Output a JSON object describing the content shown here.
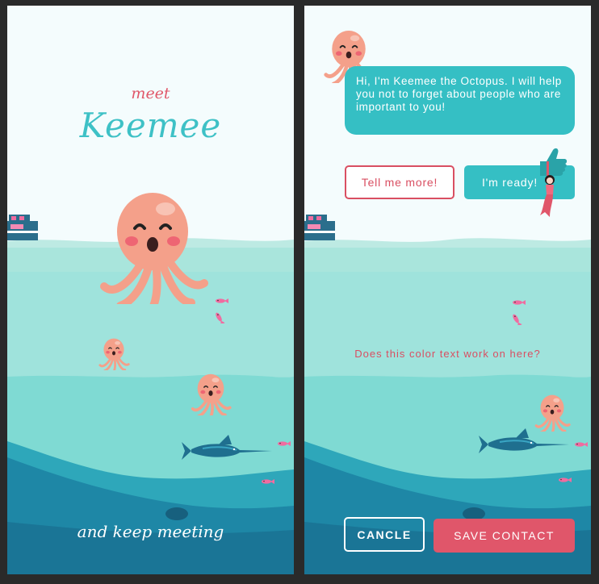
{
  "left_screen": {
    "meet_text": "meet",
    "title": "Keemee",
    "tagline": "and keep meeting"
  },
  "right_screen": {
    "chat_message": "Hi, I'm Keemee the Octopus. I will help you not to forget about people who are important to you!",
    "tell_more_label": "Tell me more!",
    "ready_label": "I'm ready!",
    "question_text": "Does this color text work on here?",
    "cancel_label": "CANCLE",
    "save_label": "SAVE CONTACT"
  },
  "colors": {
    "accent_teal": "#35bfc4",
    "accent_coral": "#e0566a",
    "octopus": "#f4a08a",
    "sky": "#f4fcfd",
    "deep_sea": "#1e7f9e"
  },
  "icons": [
    "octopus-icon",
    "boat-icon",
    "fish-icon",
    "swordfish-icon",
    "thumbs-up-icon",
    "mermaid-icon"
  ]
}
